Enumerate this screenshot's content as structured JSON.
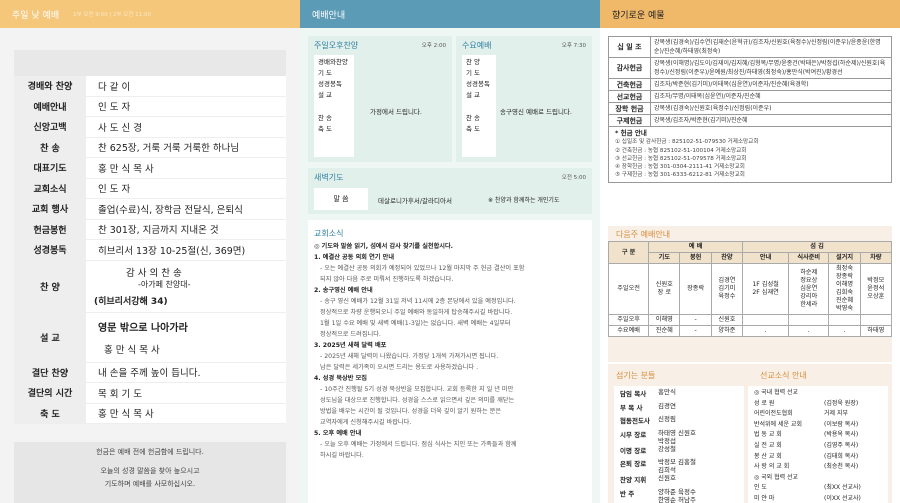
{
  "col1": {
    "title": "주일 낮 예배",
    "times": "1부 오전 9:00 | 2부 오전 11:00",
    "order": [
      {
        "label": "경배와 찬양",
        "value": "다 같 이"
      },
      {
        "label": "예배안내",
        "value": "인 도 자"
      },
      {
        "label": "신앙고백",
        "value": "사 도 신 경"
      },
      {
        "label": "찬 송",
        "value": "찬 625장, 거룩 거룩 거룩한 하나님"
      },
      {
        "label": "대표기도",
        "value": "홍 만 식 목 사"
      },
      {
        "label": "교회소식",
        "value": "인 도 자"
      },
      {
        "label": "교회 행사",
        "value": "졸업(수료)식, 장학금 전달식, 은퇴식"
      },
      {
        "label": "헌금봉헌",
        "value": "찬 301장, 지금까지 지내온 것"
      },
      {
        "label": "성경봉독",
        "value": "히브리서 13장 10-25절(신, 369면)"
      }
    ],
    "praise_label": "찬 양",
    "praise_l1": "감 사 의 찬 송",
    "praise_l2": "-아가페 찬양대-",
    "praise_l3": "(히브리서강해 34)",
    "sermon_label": "설 교",
    "sermon_l1": "영문 밖으로 나아가라",
    "sermon_l2": "홍 만 식 목 사",
    "order2": [
      {
        "label": "결단 찬양",
        "value": "내 손을 주께 높이 듭니다."
      },
      {
        "label": "결단의 시간",
        "value": "목 회 기 도"
      },
      {
        "label": "축 도",
        "value": "홍 만 식 목 사"
      }
    ],
    "footer_l1": "헌금은 예배 전에 헌금함에 드립니다.",
    "footer_l2": "오늘의 성경 말씀을 찾아 높으시고",
    "footer_l3": "기도하며 예배를 사모하십시오."
  },
  "col2": {
    "title": "예배안내",
    "pm_title": "주일오후찬양",
    "pm_time": "오후 2:00",
    "pm_items": [
      "경배와찬양",
      "기 도",
      "성경봉독",
      "설 교",
      "찬 송",
      "축 도"
    ],
    "pm_msg": "가정에서 드립니다.",
    "wed_title": "수요예배",
    "wed_time": "오후 7:30",
    "wed_items": [
      "찬 양",
      "기 도",
      "성경봉독",
      "설 교",
      "찬 송",
      "축 도"
    ],
    "wed_msg": "송구영신 예배로 드립니다.",
    "dawn_title": "새벽기도",
    "dawn_time": "오전 5:00",
    "dawn_label": "말 씀",
    "dawn_text": "데살로니가후서/갈라디아서",
    "dawn_note": "※ 찬양과 함께하는 개인기도",
    "news_title": "교회소식",
    "news": [
      {
        "t": "h",
        "s": "◎ 기도와 말씀 읽기, 섬에서 감사 찾기를 실천합시다."
      },
      {
        "t": "h",
        "s": "1. 예결산 공동 의회 연기 안내"
      },
      {
        "t": "d",
        "s": "- 오는 예결산 공동 의회가 예정되어 있었으나 12월 마지막 주 헌금 결산이 포함"
      },
      {
        "t": "d",
        "s": "되지 않아 다음 주로 미뤄서 진행하도록 하겠습니다."
      },
      {
        "t": "h",
        "s": "2. 송구영신 예배 안내"
      },
      {
        "t": "d",
        "s": "- 송구 영신 예배가 12월 31일 저녁 11시에 2층 본당에서 있을 예정입니다."
      },
      {
        "t": "d",
        "s": "정상적으로 차량 운행되오니 주일 예배와 동일하게 탑승해주시길 바랍니다."
      },
      {
        "t": "d",
        "s": "1월 1일 수요 예배 및 새벽 예배(1-3일)는 없습니다. 새벽 예배는 4일부터"
      },
      {
        "t": "d",
        "s": "정상적으로 드려집니다."
      },
      {
        "t": "h",
        "s": "3. 2025년 새해 달력 배포"
      },
      {
        "t": "d",
        "s": "- 2025년 새해 달력이 나왔습니다. 가정당 1개씩 가져가시면 됩니다."
      },
      {
        "t": "d",
        "s": "남은 달력은 세가족이 오시면 드리는 용도로 사용하겠습니다 ."
      },
      {
        "t": "h",
        "s": "4. 성경 묵상반 모집"
      },
      {
        "t": "d",
        "s": "- 10주간 진행될 5기 성경 묵상반을 모집합니다. 교회 등록한 지 일 년 미만"
      },
      {
        "t": "d",
        "s": "성도님을 대상으로 진행합니다. 성경을 스스로 읽으면서 깊은 의미를 깨닫는"
      },
      {
        "t": "d",
        "s": "방법을 배우는 시간이 될 것입니다. 성경을 더욱 깊이 알기 원하는 분은"
      },
      {
        "t": "d",
        "s": "교역자에게 신청해주시길 바랍니다."
      },
      {
        "t": "h",
        "s": "5. 오후 예배 안내"
      },
      {
        "t": "d",
        "s": "- 오늘 오후 예배는 가정에서 드립니다. 점심 식사는 지인 또는 가족들과 함께"
      },
      {
        "t": "d",
        "s": "하시길 바랍니다."
      }
    ]
  },
  "col3": {
    "title": "향기로운 예물",
    "gifts": [
      {
        "k": "십 일 조",
        "v": "강복생(김경숙)/김수연(김재순(윤혁규)/김조자/신원호(육정수)/신정림(이준우)/윤종윤(한명순)/진순혜/하태영(최정숙)"
      },
      {
        "k": "감사헌금",
        "v": "강복생(이해명)/김도이/김재이/김지혜/김형복/무명/윤종건(박태은)/박정섭(하순제)/신원호(육정수)/신정림(이준우)/윤예원/최상진/하태영(최정숙)/홍만식(박여진)/황경선"
      },
      {
        "k": "건축헌금",
        "v": "김조자/박준현(김기미)/이태목(심윤연)/이준자/진순혜(육경학)"
      },
      {
        "k": "선교헌금",
        "v": "김조자/무명/이태목(심윤연)/이준자/진순혜"
      },
      {
        "k": "장학 헌금",
        "v": "강복생(김경숙)/신원호(육정수)/신정림(이준우)"
      },
      {
        "k": "구제헌금",
        "v": "강복생/김조자/박준현(김기미)/진순혜"
      }
    ],
    "acct_title": "* 헌금 안내",
    "accounts": [
      "① 십일조 및 감사헌금 : 825102-51-079530 거제소망교회",
      "② 건축헌금 : 농협 825102-51-100104 거제소망교회",
      "③ 선교헌금 : 농협 825102-51-079578 거제소망교회",
      "④ 장학헌금 : 농협 301-0304-2111-41 거제소망교회",
      "⑤ 구제헌금 : 농협 301-6333-6212-81 거제소망교회"
    ],
    "next_title": "다음주 예배안내",
    "svc_head1": [
      "구 분",
      "예 배",
      "섬 김"
    ],
    "svc_head2": [
      "기도",
      "봉헌",
      "찬양",
      "안내",
      "식사준비",
      "설거지",
      "차량"
    ],
    "svc_rows": [
      {
        "n": "주일오전",
        "c": [
          "신원호\n장 로",
          "장종락",
          "김경연\n김기미\n육정수",
          "1F 김성철\n2F 심재연",
          "하순제\n정요상\n심윤연\n강리아\n한세라",
          "최정숙\n장종락\n이해명\n김희숙\n진순혜\n박영숙",
          "박정모\n윤정석\n오상훈"
        ]
      },
      {
        "n": "주일오후",
        "c": [
          "이해영",
          "-",
          "신원호",
          "",
          "",
          "",
          ""
        ]
      },
      {
        "n": "수요예배",
        "c": [
          "진순혜",
          "-",
          "양하준",
          ".",
          ".",
          ".",
          "하태영"
        ]
      }
    ],
    "vol_title": "섬기는 분들",
    "vol": [
      [
        "담임 목사",
        "홍만식"
      ],
      [
        "부 목 사",
        "김경연"
      ],
      [
        "협동전도사",
        "신정림"
      ],
      [
        "시무 장로",
        "하태영 신원호\n박정섭"
      ],
      [
        "이명 장로",
        "강성철"
      ],
      [
        "은퇴 장로",
        "박정모 김홍철\n김희석"
      ],
      [
        "찬양 지휘",
        "신원호"
      ],
      [
        "반 주",
        "양하준 육정수\n한영순 허남주"
      ]
    ],
    "mission_title": "선교소식 안내",
    "m_dom": "◎ 국내 협력 선교",
    "m_list": [
      [
        "성 로 원",
        "(김정욱 원장)"
      ],
      [
        "어린이전도협회",
        "거제 지부"
      ],
      [
        "반석위에 세운 교회",
        "(이보람 목사)"
      ],
      [
        "법 동 교 회",
        "(박용옥 목사)"
      ],
      [
        "실 전 교 회",
        "(김영주 목사)"
      ],
      [
        "봉 산 교 회",
        "(김태희 목사)"
      ],
      [
        "사 랑 의 교 회",
        "(최승천 목사)"
      ]
    ],
    "m_int": "◎ 국외 협력 선교",
    "m_list2": [
      [
        "인 도",
        "(최XX 선교사)"
      ],
      [
        "미 얀 마",
        "(이XX 선교사)"
      ]
    ]
  }
}
